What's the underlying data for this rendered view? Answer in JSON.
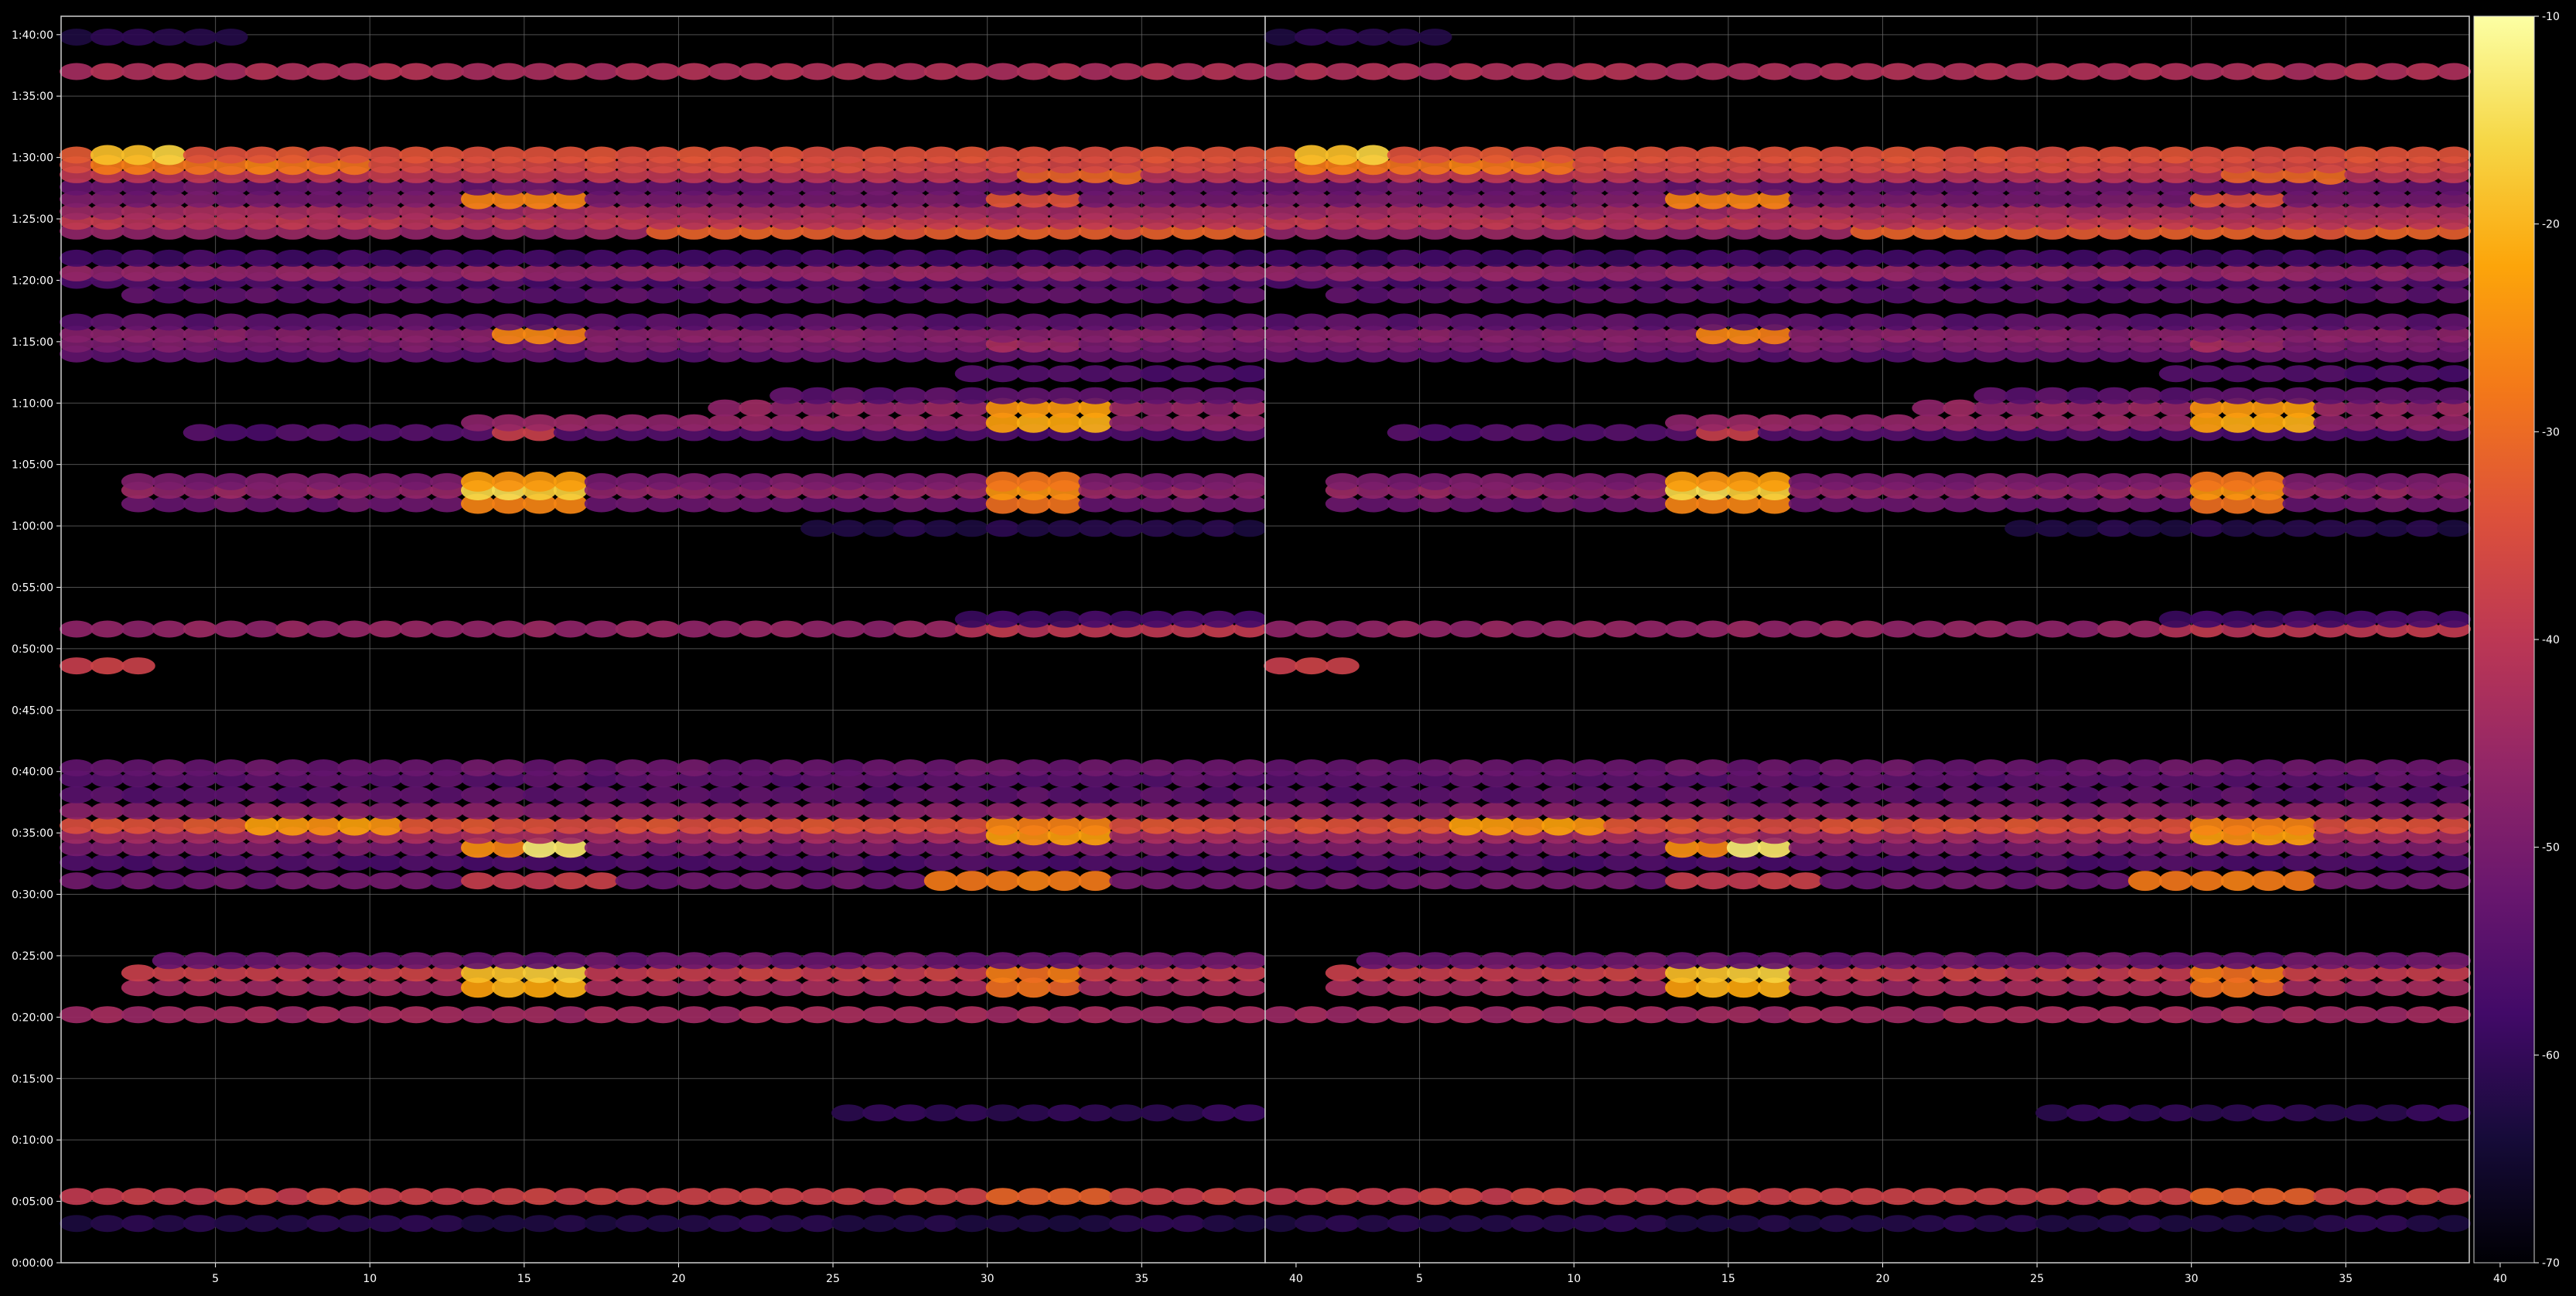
{
  "chart_data": {
    "type": "heatmap",
    "title": "",
    "xlabel": "",
    "ylabel": "",
    "colormap": "inferno",
    "background": "#000000",
    "grid": true,
    "value_range": [
      -70,
      -10
    ],
    "colorbar": {
      "ticks": [
        -10,
        -20,
        -30,
        -40,
        -50,
        -60,
        -70
      ]
    },
    "panels": [
      {
        "xlim": [
          1,
          40
        ],
        "x_ticks": [
          "5",
          "10",
          "15",
          "20",
          "25",
          "30",
          "35",
          "40"
        ]
      },
      {
        "xlim": [
          40,
          79
        ],
        "x_ticks": [
          "5",
          "10",
          "15",
          "20",
          "25",
          "30",
          "35",
          "40"
        ]
      }
    ],
    "y_unit": "minutes",
    "ylim": [
      0,
      101.5
    ],
    "y_ticks": [
      "0:00:00",
      "0:05:00",
      "0:10:00",
      "0:15:00",
      "0:20:00",
      "0:25:00",
      "0:30:00",
      "0:35:00",
      "0:40:00",
      "0:45:00",
      "0:50:00",
      "0:55:00",
      "1:00:00",
      "1:05:00",
      "1:10:00",
      "1:15:00",
      "1:20:00",
      "1:25:00",
      "1:30:00",
      "1:35:00",
      "1:40:00"
    ],
    "column_count_per_panel": 40,
    "bands": [
      {
        "y": 3.2,
        "level": -62,
        "cols": [
          1,
          40
        ]
      },
      {
        "y": 5.4,
        "level": -38,
        "cols": [
          1,
          40
        ],
        "peaks": [
          {
            "cols": [
              31,
              34
            ],
            "level": -31
          }
        ]
      },
      {
        "y": 12.2,
        "level": -60,
        "cols": [
          26,
          40
        ]
      },
      {
        "y": 20.2,
        "level": -44,
        "cols": [
          1,
          40
        ]
      },
      {
        "y": 22.4,
        "level": -44,
        "cols": [
          3,
          40
        ],
        "peaks": [
          {
            "cols": [
              14,
              17
            ],
            "level": -22
          },
          {
            "cols": [
              31,
              33
            ],
            "level": -30
          }
        ]
      },
      {
        "y": 23.6,
        "level": -38,
        "cols": [
          3,
          40
        ],
        "peaks": [
          {
            "cols": [
              14,
              17
            ],
            "level": -18
          },
          {
            "cols": [
              31,
              33
            ],
            "level": -28
          }
        ]
      },
      {
        "y": 24.6,
        "level": -52,
        "cols": [
          4,
          40
        ]
      },
      {
        "y": 31.1,
        "level": -52,
        "cols": [
          1,
          40
        ],
        "peaks": [
          {
            "cols": [
              14,
              18
            ],
            "level": -38
          },
          {
            "cols": [
              29,
              34
            ],
            "level": -28
          }
        ]
      },
      {
        "y": 32.6,
        "level": -56,
        "cols": [
          1,
          40
        ]
      },
      {
        "y": 33.8,
        "level": -50,
        "cols": [
          1,
          40
        ],
        "peaks": [
          {
            "cols": [
              14,
              16
            ],
            "level": -26
          },
          {
            "cols": [
              16,
              17
            ],
            "level": -14
          }
        ]
      },
      {
        "y": 34.8,
        "level": -44,
        "cols": [
          1,
          40
        ],
        "peaks": [
          {
            "cols": [
              31,
              34
            ],
            "level": -24
          }
        ]
      },
      {
        "y": 35.6,
        "level": -34,
        "cols": [
          1,
          40
        ],
        "peaks": [
          {
            "cols": [
              7,
              11
            ],
            "level": -24
          },
          {
            "cols": [
              31,
              34
            ],
            "level": -26
          }
        ]
      },
      {
        "y": 36.8,
        "level": -48,
        "cols": [
          1,
          40
        ]
      },
      {
        "y": 38.1,
        "level": -54,
        "cols": [
          1,
          40
        ]
      },
      {
        "y": 39.4,
        "level": -54,
        "cols": [
          1,
          40
        ]
      },
      {
        "y": 40.3,
        "level": -52,
        "cols": [
          1,
          40
        ]
      },
      {
        "y": 48.6,
        "level": -38,
        "cols": [
          1,
          3
        ]
      },
      {
        "y": 51.6,
        "level": -46,
        "cols": [
          1,
          40
        ],
        "peaks": [
          {
            "cols": [
              30,
              40
            ],
            "level": -40
          }
        ]
      },
      {
        "y": 52.4,
        "level": -58,
        "cols": [
          30,
          40
        ]
      },
      {
        "y": 59.8,
        "level": -62,
        "cols": [
          25,
          40
        ]
      },
      {
        "y": 61.8,
        "level": -52,
        "cols": [
          3,
          40
        ],
        "peaks": [
          {
            "cols": [
              14,
              17
            ],
            "level": -26
          },
          {
            "cols": [
              31,
              33
            ],
            "level": -30
          }
        ]
      },
      {
        "y": 62.9,
        "level": -46,
        "cols": [
          3,
          40
        ],
        "peaks": [
          {
            "cols": [
              14,
              17
            ],
            "level": -16
          },
          {
            "cols": [
              31,
              33
            ],
            "level": -24
          }
        ]
      },
      {
        "y": 63.6,
        "level": -50,
        "cols": [
          3,
          40
        ],
        "peaks": [
          {
            "cols": [
              14,
              17
            ],
            "level": -24
          },
          {
            "cols": [
              31,
              33
            ],
            "level": -28
          }
        ]
      },
      {
        "y": 67.6,
        "level": -56,
        "cols": [
          5,
          40
        ],
        "peaks": [
          {
            "cols": [
              15,
              16
            ],
            "level": -38
          }
        ]
      },
      {
        "y": 68.4,
        "level": -46,
        "cols": [
          14,
          40
        ],
        "peaks": [
          {
            "cols": [
              31,
              34
            ],
            "level": -22
          }
        ]
      },
      {
        "y": 69.6,
        "level": -46,
        "cols": [
          22,
          40
        ],
        "peaks": [
          {
            "cols": [
              31,
              34
            ],
            "level": -24
          }
        ]
      },
      {
        "y": 70.6,
        "level": -54,
        "cols": [
          24,
          40
        ]
      },
      {
        "y": 72.4,
        "level": -56,
        "cols": [
          30,
          40
        ]
      },
      {
        "y": 74.0,
        "level": -54,
        "cols": [
          1,
          40
        ]
      },
      {
        "y": 74.8,
        "level": -50,
        "cols": [
          1,
          40
        ],
        "peaks": [
          {
            "cols": [
              31,
              33
            ],
            "level": -44
          }
        ]
      },
      {
        "y": 75.6,
        "level": -48,
        "cols": [
          1,
          40
        ],
        "peaks": [
          {
            "cols": [
              15,
              17
            ],
            "level": -26
          }
        ]
      },
      {
        "y": 76.6,
        "level": -54,
        "cols": [
          1,
          40
        ]
      },
      {
        "y": 78.8,
        "level": -54,
        "cols": [
          3,
          40
        ]
      },
      {
        "y": 80.0,
        "level": -56,
        "cols": [
          1,
          40
        ]
      },
      {
        "y": 80.6,
        "level": -46,
        "cols": [
          1,
          40
        ]
      },
      {
        "y": 81.8,
        "level": -58,
        "cols": [
          1,
          40
        ]
      },
      {
        "y": 84.0,
        "level": -46,
        "cols": [
          1,
          40
        ],
        "peaks": [
          {
            "cols": [
              20,
              40
            ],
            "level": -32
          }
        ]
      },
      {
        "y": 84.8,
        "level": -40,
        "cols": [
          1,
          40
        ]
      },
      {
        "y": 85.6,
        "level": -44,
        "cols": [
          1,
          40
        ]
      },
      {
        "y": 86.6,
        "level": -50,
        "cols": [
          1,
          40
        ],
        "peaks": [
          {
            "cols": [
              14,
              17
            ],
            "level": -26
          },
          {
            "cols": [
              31,
              33
            ],
            "level": -34
          }
        ]
      },
      {
        "y": 87.6,
        "level": -52,
        "cols": [
          1,
          40
        ]
      },
      {
        "y": 88.6,
        "level": -40,
        "cols": [
          1,
          40
        ],
        "peaks": [
          {
            "cols": [
              32,
              35
            ],
            "level": -30
          }
        ]
      },
      {
        "y": 89.4,
        "level": -36,
        "cols": [
          1,
          40
        ],
        "peaks": [
          {
            "cols": [
              2,
              10
            ],
            "level": -28
          }
        ]
      },
      {
        "y": 90.2,
        "level": -34,
        "cols": [
          1,
          40
        ],
        "peaks": [
          {
            "cols": [
              2,
              4
            ],
            "level": -18
          }
        ]
      },
      {
        "y": 97.0,
        "level": -42,
        "cols": [
          1,
          40
        ]
      },
      {
        "y": 99.8,
        "level": -62,
        "cols": [
          1,
          6
        ]
      }
    ]
  }
}
